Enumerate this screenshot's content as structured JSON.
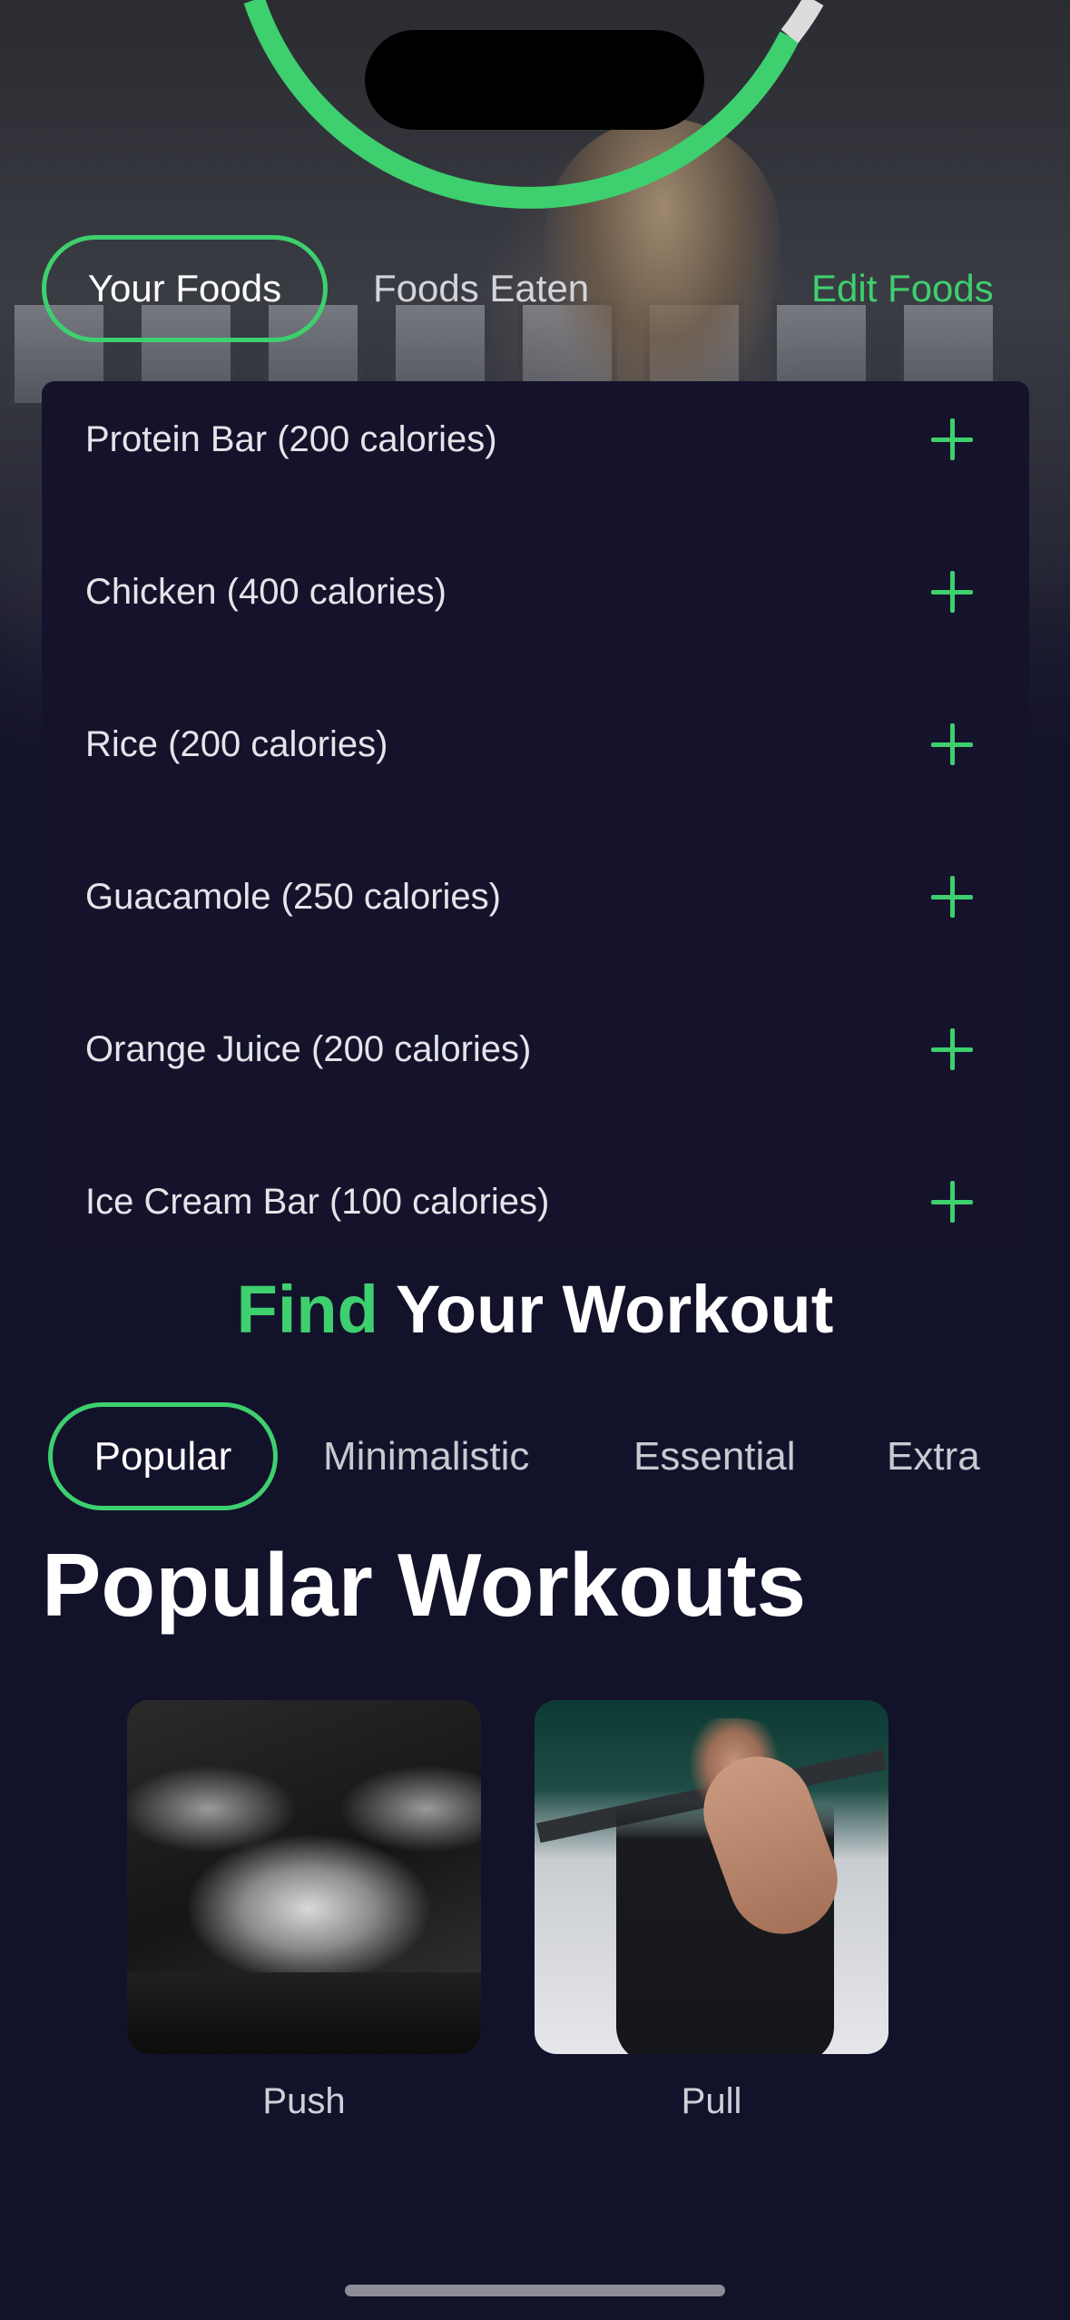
{
  "food_tabs": {
    "your_foods": "Your Foods",
    "foods_eaten": "Foods Eaten",
    "edit_foods": "Edit Foods"
  },
  "foods": [
    {
      "name": "Protein Bar (200 calories)"
    },
    {
      "name": "Chicken (400 calories)"
    },
    {
      "name": "Rice (200 calories)"
    },
    {
      "name": "Guacamole (250 calories)"
    },
    {
      "name": "Orange Juice (200 calories)"
    },
    {
      "name": "Ice Cream Bar (100 calories)"
    }
  ],
  "find_heading": {
    "accent": "Find",
    "rest": "Your Workout"
  },
  "workout_tabs": [
    "Popular",
    "Minimalistic",
    "Essential",
    "Extra"
  ],
  "popular_title": "Popular Workouts",
  "workouts": [
    {
      "label": "Push"
    },
    {
      "label": "Pull"
    }
  ],
  "colors": {
    "accent": "#3ecf6e",
    "background": "#13122b"
  }
}
